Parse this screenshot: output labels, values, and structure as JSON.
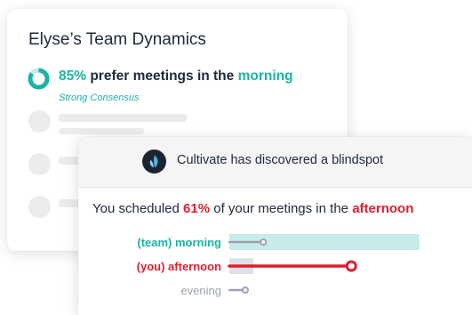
{
  "team_card": {
    "title": "Elyse’s Team Dynamics",
    "percent": "85%",
    "phrase": "prefer meetings in the",
    "time": "morning",
    "consensus": "Strong Consensus",
    "progress": 0.85
  },
  "blindspot_card": {
    "header": "Cultivate has discovered a blindspot",
    "logo_icon": "cultivate-leaf-logo",
    "sentence_start": "You scheduled",
    "percent": "61%",
    "sentence_mid": "of your meetings in the",
    "time": "afternoon"
  },
  "colors": {
    "teal": "#1bb3a6",
    "red": "#e11d2e",
    "teal_light": "#c7eaea",
    "gray": "#9ca3af"
  },
  "chart_data": {
    "type": "bar",
    "categories": [
      "(team) morning",
      "(you) afternoon",
      "evening"
    ],
    "series": [
      {
        "values": [
          0.95,
          0.12,
          0
        ]
      },
      {
        "values": [
          0.17,
          0.61,
          0.08
        ]
      }
    ]
  }
}
